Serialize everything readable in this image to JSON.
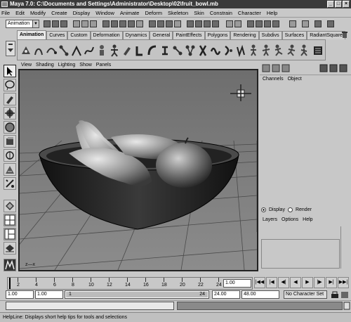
{
  "window": {
    "title": "Maya 7.0: C:\\Documents and Settings\\Administrator\\Desktop\\02\\fruit_bowl.mb",
    "buttons": [
      "_",
      "□",
      "×"
    ]
  },
  "menubar": [
    "File",
    "Edit",
    "Modify",
    "Create",
    "Display",
    "Window",
    "Animate",
    "Deform",
    "Skeleton",
    "Skin",
    "Constrain",
    "Character",
    "Help"
  ],
  "statusline": {
    "menuset": "Animation"
  },
  "shelf": {
    "tabs": [
      "Animation",
      "Curves",
      "Custom",
      "Deformation",
      "Dynamics",
      "General",
      "PaintEffects",
      "Polygons",
      "Rendering",
      "Subdivs",
      "Surfaces",
      "RadiantSquare"
    ],
    "active_tab": "Animation"
  },
  "viewport": {
    "menus": [
      "View",
      "Shading",
      "Lighting",
      "Show",
      "Panels"
    ],
    "axis_label": "z—x"
  },
  "channelbox": {
    "headers": [
      "Channels",
      "Object"
    ]
  },
  "layers": {
    "display_label": "Display",
    "render_label": "Render",
    "menus": [
      "Layers",
      "Options",
      "Help"
    ]
  },
  "timeslider": {
    "ticks": [
      "2",
      "4",
      "6",
      "8",
      "10",
      "12",
      "14",
      "16",
      "18",
      "20",
      "22",
      "24"
    ],
    "current_frame": "1.00"
  },
  "range": {
    "start_time": "1.00",
    "playback_start": "1.00",
    "range_start_label": "1",
    "range_end_label": "24",
    "playback_end": "24.00",
    "end_time": "48.00",
    "character_set": "No Character Set"
  },
  "helpline": {
    "text": "HelpLine: Displays short help tips for tools and selections"
  }
}
